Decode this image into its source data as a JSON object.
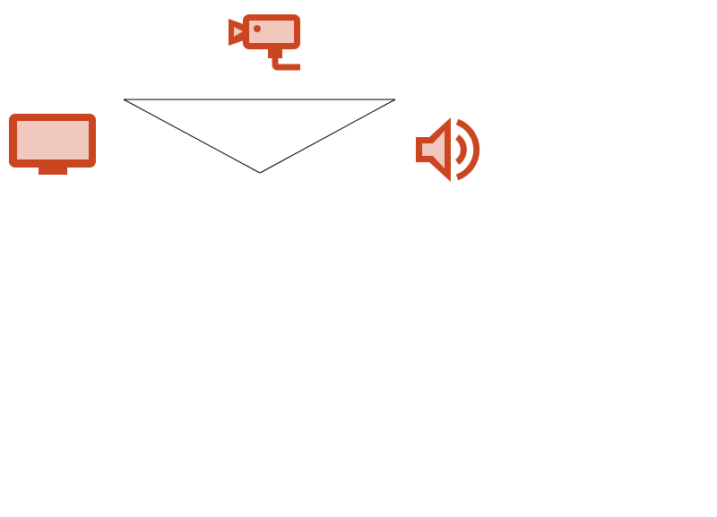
{
  "colors": {
    "icon_stroke": "#CC4521",
    "icon_fill": "#F0C8BE",
    "edge": "#000000",
    "background": "#FFFFFF"
  },
  "nodes": [
    {
      "id": "camera",
      "icon": "security-camera-icon"
    },
    {
      "id": "monitor",
      "icon": "monitor-icon"
    },
    {
      "id": "speaker",
      "icon": "speaker-icon"
    }
  ],
  "edges": [
    {
      "from": "camera",
      "to": "monitor"
    },
    {
      "from": "monitor",
      "to": "speaker"
    },
    {
      "from": "speaker",
      "to": "camera"
    }
  ]
}
